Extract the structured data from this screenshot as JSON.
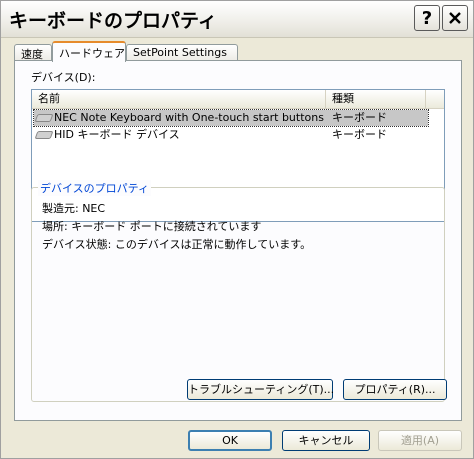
{
  "window": {
    "title": "キーボードのプロパティ"
  },
  "titlebar": {
    "help_label": "?",
    "close_icon": "close-icon"
  },
  "tabs": [
    {
      "label": "速度"
    },
    {
      "label": "ハードウェア"
    },
    {
      "label": "SetPoint Settings"
    }
  ],
  "devices": {
    "label": "デバイス(D):",
    "columns": [
      "名前",
      "種類"
    ],
    "rows": [
      {
        "name": "NEC Note Keyboard with One-touch start buttons",
        "type": "キーボード",
        "selected": true
      },
      {
        "name": "HID キーボード デバイス",
        "type": "キーボード",
        "selected": false
      }
    ]
  },
  "properties": {
    "title": "デバイスのプロパティ",
    "manufacturer": "製造元: NEC",
    "location": "場所: キーボード ポートに接続されています",
    "status": "デバイス状態: このデバイスは正常に動作しています。"
  },
  "buttons": {
    "troubleshoot": "トラブルシューティング(T)...",
    "properties": "プロパティ(R)...",
    "ok": "OK",
    "cancel": "キャンセル",
    "apply": "適用(A)"
  }
}
